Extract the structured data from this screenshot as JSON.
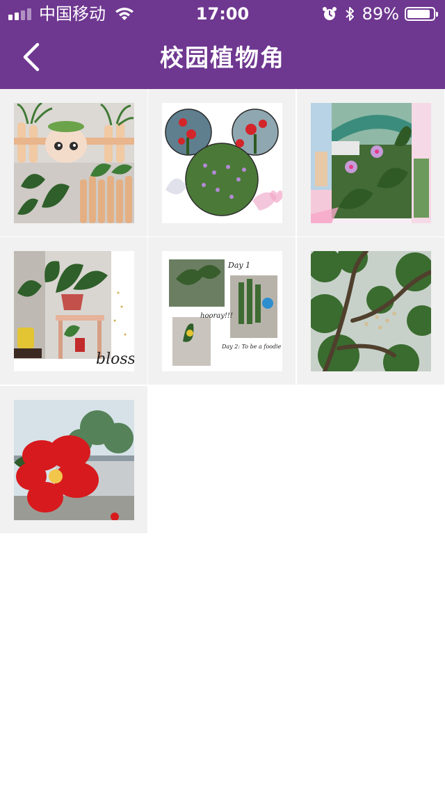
{
  "status_bar": {
    "carrier": "中国移动",
    "time": "17:00",
    "battery_percent": "89%",
    "battery_level": 0.89,
    "icons": [
      "signal-icon",
      "wifi-icon",
      "alarm-icon",
      "bluetooth-icon",
      "battery-icon"
    ]
  },
  "nav": {
    "title": "校园植物角",
    "back_icon": "chevron-left-icon"
  },
  "theme": {
    "header_bg": "#6e3790",
    "grid_bg": "#f1f1f1"
  },
  "gallery": {
    "items": [
      {
        "subject": "potted plants with fence planters"
      },
      {
        "subject": "mickey-shaped flower collage"
      },
      {
        "subject": "pink periwinkle flower collage"
      },
      {
        "subject": "peace lily on wooden stand collage"
      },
      {
        "subject": "plant journal collage"
      },
      {
        "subject": "tree branches with blossoms"
      },
      {
        "subject": "red camellia flower"
      }
    ],
    "collage_text": {
      "blossom": "bloss",
      "day1": "Day 1",
      "hooray": "hooray!!!",
      "day2": "Day 2: To be a foodie"
    }
  }
}
